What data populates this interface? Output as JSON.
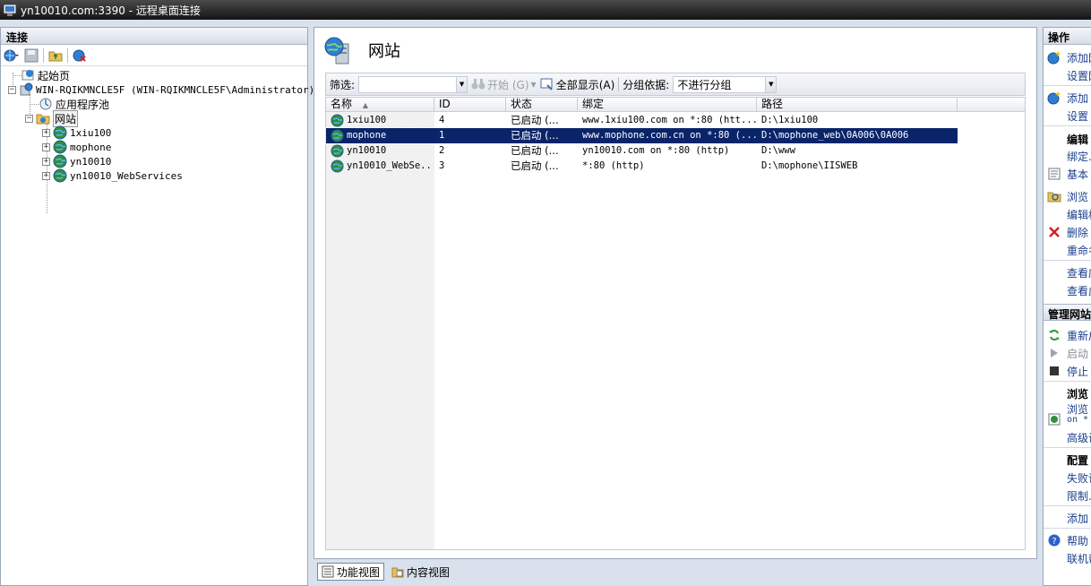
{
  "window": {
    "title": "yn10010.com:3390 - 远程桌面连接"
  },
  "left_panel": {
    "header": "连接",
    "tree": [
      {
        "label": "起始页"
      },
      {
        "label": "WIN-RQIKMNCLE5F (WIN-RQIKMNCLE5F\\Administrator)"
      },
      {
        "label": "应用程序池"
      },
      {
        "label": "网站"
      },
      {
        "label": "1xiu100"
      },
      {
        "label": "mophone"
      },
      {
        "label": "yn10010"
      },
      {
        "label": "yn10010_WebServices"
      }
    ]
  },
  "center": {
    "title": "网站",
    "filter_label": "筛选:",
    "start_label": "开始 (G)",
    "show_all_label": "全部显示(A)",
    "group_label": "分组依据:",
    "group_value": "不进行分组",
    "columns": [
      "名称",
      "ID",
      "状态",
      "绑定",
      "路径"
    ],
    "rows": [
      {
        "name": "1xiu100",
        "id": "4",
        "status": "已启动 (...",
        "binding": "www.1xiu100.com on *:80 (htt...",
        "path": "D:\\1xiu100"
      },
      {
        "name": "mophone",
        "id": "1",
        "status": "已启动 (...",
        "binding": "www.mophone.com.cn on *:80 (...",
        "path": "D:\\mophone_web\\0A006\\0A006"
      },
      {
        "name": "yn10010",
        "id": "2",
        "status": "已启动 (...",
        "binding": "yn10010.com on *:80 (http)",
        "path": "D:\\www"
      },
      {
        "name": "yn10010_WebSe...",
        "id": "3",
        "status": "已启动 (...",
        "binding": "*:80 (http)",
        "path": "D:\\mophone\\IISWEB"
      }
    ],
    "selected_row": 1
  },
  "bottom_tabs": {
    "features_view": "功能视图",
    "content_view": "内容视图"
  },
  "right_panel": {
    "header": "操作",
    "add_site": "添加网",
    "set_defaults": "设置网",
    "add_ftp": "添加",
    "set_ftp": "设置",
    "edit_head": "编辑",
    "bindings": "绑定...",
    "basic_settings": "基本",
    "explore": "浏览",
    "edit_permissions": "编辑权",
    "delete": "删除",
    "rename": "重命名",
    "view_apps": "查看应",
    "view_vdirs": "查看虚",
    "manage_head": "管理网站",
    "restart": "重新启",
    "start": "启动",
    "stop": "停止",
    "browse_head": "浏览",
    "browse_line1": "浏览",
    "browse_line2": "on *",
    "advanced": "高级设",
    "config_head": "配置",
    "failed_request": "失败请",
    "limits": "限制...",
    "add_ftp_publish": "添加",
    "help": "帮助",
    "online_help": "联机帮"
  }
}
